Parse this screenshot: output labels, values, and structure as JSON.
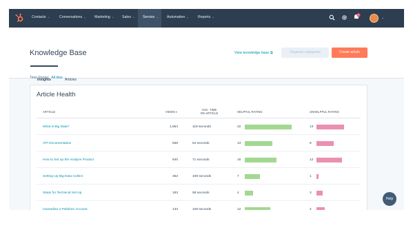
{
  "nav": {
    "items": [
      {
        "label": "Contacts"
      },
      {
        "label": "Conversations"
      },
      {
        "label": "Marketing"
      },
      {
        "label": "Sales"
      },
      {
        "label": "Service"
      },
      {
        "label": "Automation"
      },
      {
        "label": "Reports"
      }
    ],
    "active_index": 4,
    "notification_count": "1",
    "icons": [
      "search-icon",
      "gear-icon",
      "notification-bell-icon",
      "avatar",
      "chevron-down-icon"
    ]
  },
  "header": {
    "title": "Knowledge Base",
    "view_link": "View knowledge base",
    "organize_label": "Organize categories",
    "create_label": "Create article"
  },
  "tabs": [
    {
      "label": "Insights",
      "active": true
    },
    {
      "label": "Articles",
      "active": false
    }
  ],
  "filter": {
    "label": "Time Range:",
    "value": "All time"
  },
  "card": {
    "title": "Article Health",
    "columns": {
      "article": "ARTICLE",
      "views": "VIEWS",
      "avg_time_1": "AVG. TIME",
      "avg_time_2": "ON ARTICLE",
      "helpful": "HELPFUL RATING",
      "unhelpful": "UNHELPFUL RATING"
    },
    "rows": [
      {
        "article": "What is Big Data?",
        "views": "1,564",
        "avg_time": "118 seconds",
        "helpful": "22",
        "unhelpful": "13"
      },
      {
        "article": "API Documentation",
        "views": "658",
        "avg_time": "54 seconds",
        "helpful": "13",
        "unhelpful": "8"
      },
      {
        "article": "How to Set up the Analyze Product",
        "views": "640",
        "avg_time": "71 seconds",
        "helpful": "15",
        "unhelpful": "12"
      },
      {
        "article": "Setting Up Big Data Collect",
        "views": "353",
        "avg_time": "169 seconds",
        "helpful": "7",
        "unhelpful": "1"
      },
      {
        "article": "Steps for Technical Set Up",
        "views": "183",
        "avg_time": "58 seconds",
        "helpful": "4",
        "unhelpful": "3"
      },
      {
        "article": "Upgrading a Poliphon Account",
        "views": "133",
        "avg_time": "108 seconds",
        "helpful": "12",
        "unhelpful": "4"
      }
    ]
  },
  "help": {
    "label": "Help"
  },
  "colors": {
    "nav_bg": "#2d3e50",
    "accent": "#ff7a59",
    "link": "#0091ae",
    "helpful_bar": "#a3d891",
    "unhelpful_bar": "#ea90b1"
  }
}
